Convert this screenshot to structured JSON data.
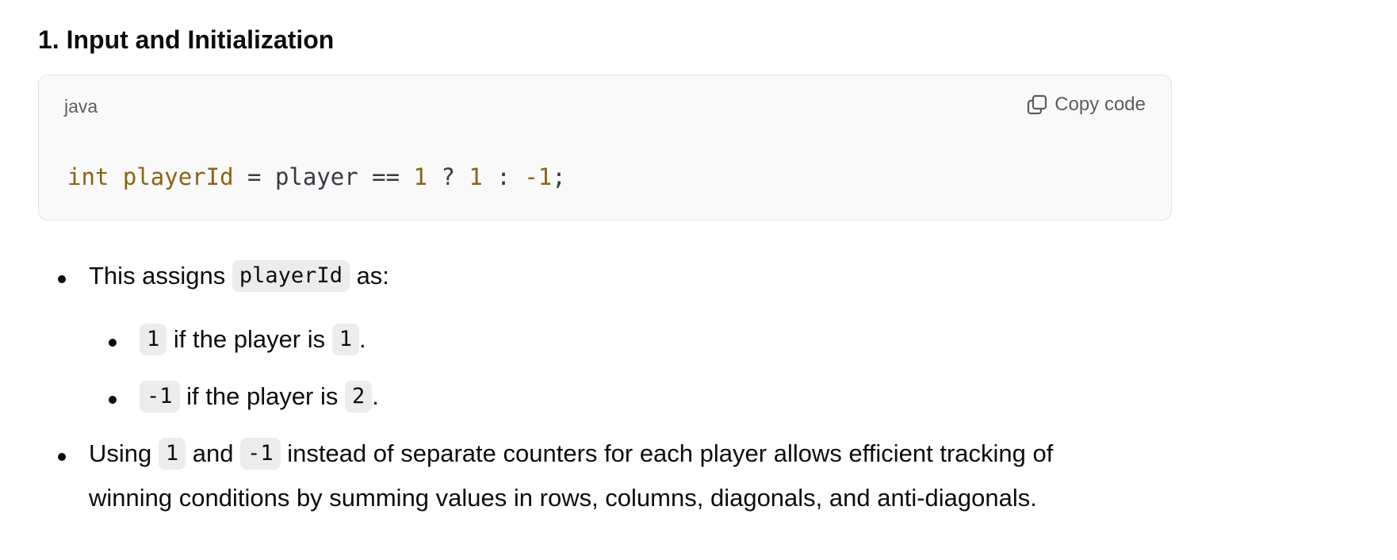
{
  "section": {
    "heading": "1. Input and Initialization"
  },
  "code_block": {
    "language": "java",
    "copy_label": "Copy code",
    "copy_icon": "copy-icon",
    "tokens": {
      "kw_int": "int",
      "ident_playerId": "playerId",
      "op_assign": " = ",
      "ident_player": "player",
      "op_eq": " == ",
      "num_1a": "1",
      "op_q": " ? ",
      "num_1b": "1",
      "op_colon": " : ",
      "num_neg1": "-1",
      "semi": ";"
    }
  },
  "bullets": {
    "b1": {
      "before": "This assigns ",
      "code": "playerId",
      "after": " as:"
    },
    "b1a": {
      "code1": "1",
      "text": " if the player is ",
      "code2": "1",
      "after": "."
    },
    "b1b": {
      "code1": "-1",
      "text": " if the player is ",
      "code2": "2",
      "after": "."
    },
    "b2": {
      "t1": "Using ",
      "code1": "1",
      "t2": " and ",
      "code2": "-1",
      "t3": " instead of separate counters for each player allows efficient tracking of",
      "t4": "winning conditions by summing values in rows, columns, diagonals, and anti-diagonals."
    }
  }
}
